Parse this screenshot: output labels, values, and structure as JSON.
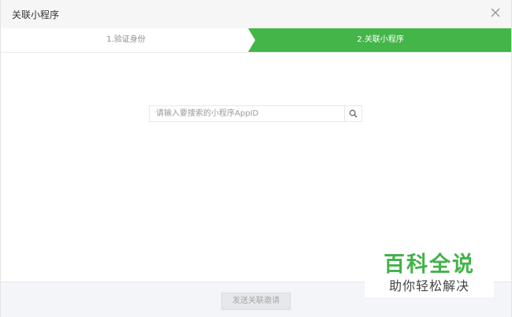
{
  "dialog": {
    "title": "关联小程序",
    "close_icon": "close-icon"
  },
  "steps": [
    {
      "label": "1.验证身份",
      "active": false
    },
    {
      "label": "2.关联小程序",
      "active": true
    }
  ],
  "search": {
    "placeholder": "请输入要搜索的小程序AppID",
    "value": "",
    "icon": "search-icon"
  },
  "footer": {
    "send_label": "发送关联邀请"
  },
  "watermark": {
    "line1": "百科全说",
    "line2": "助你轻松解决"
  },
  "colors": {
    "accent": "#44b549",
    "titlebar": "#f6f6f6",
    "footer": "#f4f5f9"
  }
}
